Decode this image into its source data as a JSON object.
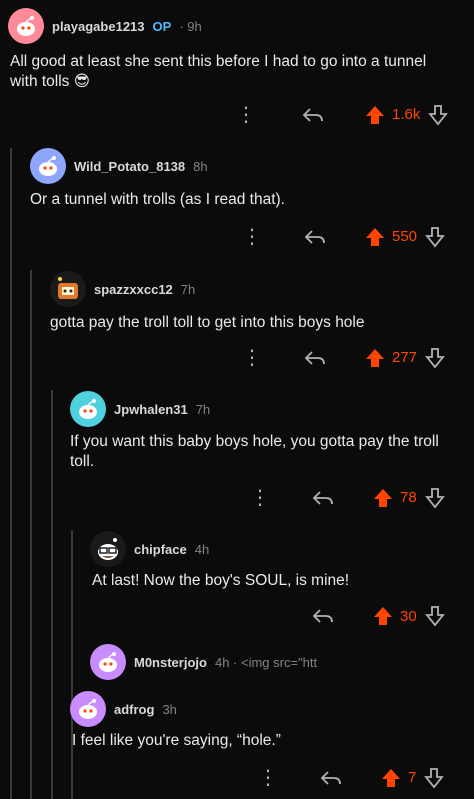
{
  "comments": [
    {
      "user": "playagabe1213",
      "op": "OP",
      "time": "9h",
      "text": "All good at least she sent this before I had to go into a tunnel with tolls 😎",
      "score": "1.6k",
      "avatar_color": "#ff8b9a"
    },
    {
      "user": "Wild_Potato_8138",
      "time": "8h",
      "text": "Or a tunnel with trolls (as I read that).",
      "score": "550",
      "avatar_color": "#8fa6ff"
    },
    {
      "user": "spazzxxcc12",
      "time": "7h",
      "text": "gotta pay the troll toll to get into this boys hole",
      "score": "277",
      "avatar_color": "#e07a2a"
    },
    {
      "user": "Jpwhalen31",
      "time": "7h",
      "text": "If you want this baby boys hole, you gotta pay the troll toll.",
      "score": "78",
      "avatar_color": "#4fd1e0"
    },
    {
      "user": "chipface",
      "time": "4h",
      "text": "At last! Now the boy's SOUL, is mine!",
      "score": "30",
      "avatar_color": "#222222"
    },
    {
      "user": "M0nsterjojo",
      "time": "4h",
      "extra": "<img src=\"htt",
      "avatar_color": "#c98cff"
    },
    {
      "user": "adfrog",
      "time": "3h",
      "text": "I feel like you're saying, “hole.”",
      "score": "7",
      "avatar_color": "#c98cff"
    }
  ],
  "colors": {
    "upvote": "#ff4500",
    "op": "#4fbcff",
    "thread": "#3a3a3c"
  }
}
